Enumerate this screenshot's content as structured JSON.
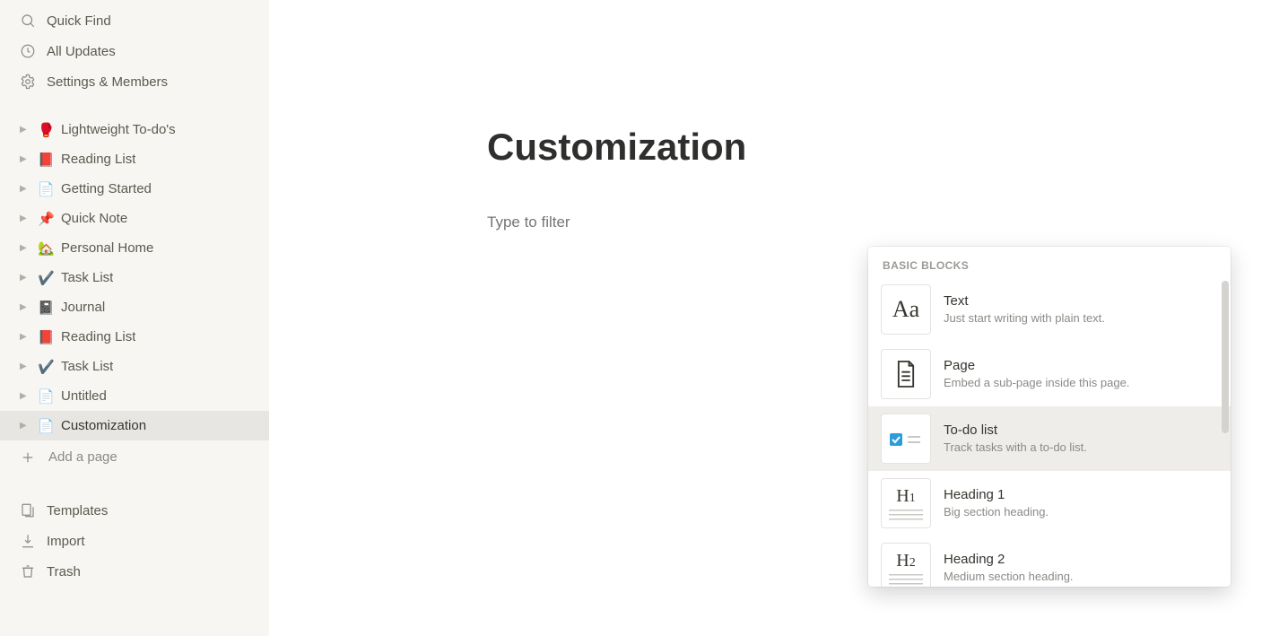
{
  "sidebar": {
    "top": [
      {
        "label": "Quick Find",
        "icon": "search"
      },
      {
        "label": "All Updates",
        "icon": "clock"
      },
      {
        "label": "Settings & Members",
        "icon": "gear"
      }
    ],
    "pages": [
      {
        "emoji": "🥊",
        "label": "Lightweight To-do's",
        "active": false
      },
      {
        "emoji": "📕",
        "label": "Reading List",
        "active": false
      },
      {
        "emoji": "📄",
        "label": "Getting Started",
        "active": false
      },
      {
        "emoji": "📌",
        "label": "Quick Note",
        "active": false
      },
      {
        "emoji": "🏡",
        "label": "Personal Home",
        "active": false
      },
      {
        "emoji": "✔️",
        "label": "Task List",
        "active": false
      },
      {
        "emoji": "📓",
        "label": "Journal",
        "active": false
      },
      {
        "emoji": "📕",
        "label": "Reading List",
        "active": false
      },
      {
        "emoji": "✔️",
        "label": "Task List",
        "active": false
      },
      {
        "emoji": "📄",
        "label": "Untitled",
        "active": false
      },
      {
        "emoji": "📄",
        "label": "Customization",
        "active": true
      }
    ],
    "add_label": "Add a page",
    "footer": [
      {
        "label": "Templates",
        "icon": "templates"
      },
      {
        "label": "Import",
        "icon": "import"
      },
      {
        "label": "Trash",
        "icon": "trash"
      }
    ]
  },
  "main": {
    "title": "Customization",
    "filter_placeholder": "Type to filter"
  },
  "popup": {
    "section": "BASIC BLOCKS",
    "highlighted_index": 2,
    "items": [
      {
        "thumb": "Aa",
        "title": "Text",
        "desc": "Just start writing with plain text.",
        "kind": "text"
      },
      {
        "thumb": "page",
        "title": "Page",
        "desc": "Embed a sub-page inside this page.",
        "kind": "page"
      },
      {
        "thumb": "todo",
        "title": "To-do list",
        "desc": "Track tasks with a to-do list.",
        "kind": "todo"
      },
      {
        "thumb": "H1",
        "title": "Heading 1",
        "desc": "Big section heading.",
        "kind": "h1"
      },
      {
        "thumb": "H2",
        "title": "Heading 2",
        "desc": "Medium section heading.",
        "kind": "h2"
      }
    ]
  }
}
